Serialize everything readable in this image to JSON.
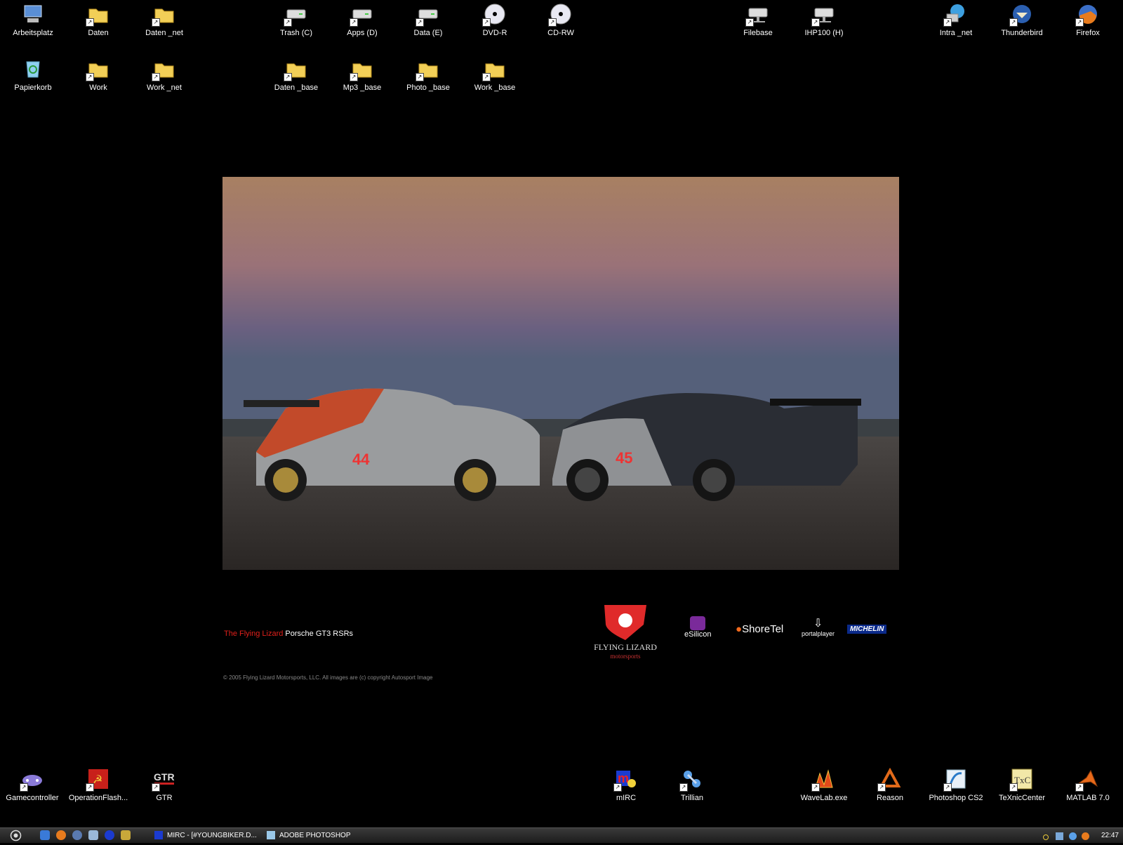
{
  "desktop": {
    "icons_top": [
      {
        "label": "Arbeitsplatz",
        "icon": "computer-icon"
      },
      {
        "label": "Daten",
        "icon": "folder-icon"
      },
      {
        "label": "Daten _net",
        "icon": "folder-icon"
      },
      {
        "label": "Trash (C)",
        "icon": "drive-icon"
      },
      {
        "label": "Apps (D)",
        "icon": "drive-icon"
      },
      {
        "label": "Data (E)",
        "icon": "drive-icon"
      },
      {
        "label": "DVD-R",
        "icon": "dvd-icon"
      },
      {
        "label": "CD-RW",
        "icon": "cd-icon"
      },
      {
        "label": "Filebase",
        "icon": "network-drive-icon"
      },
      {
        "label": "IHP100 (H)",
        "icon": "network-drive-icon"
      },
      {
        "label": "Intra _net",
        "icon": "network-icon"
      },
      {
        "label": "Thunderbird",
        "icon": "thunderbird-icon"
      },
      {
        "label": "Firefox",
        "icon": "firefox-icon"
      },
      {
        "label": "Papierkorb",
        "icon": "recycle-bin-icon"
      },
      {
        "label": "Work",
        "icon": "folder-icon"
      },
      {
        "label": "Work _net",
        "icon": "folder-icon"
      },
      {
        "label": "Daten _base",
        "icon": "folder-icon"
      },
      {
        "label": "Mp3 _base",
        "icon": "folder-icon"
      },
      {
        "label": "Photo _base",
        "icon": "folder-icon"
      },
      {
        "label": "Work _base",
        "icon": "folder-icon"
      }
    ],
    "icons_bottom": [
      {
        "label": "Gamecontroller",
        "icon": "gamepad-icon"
      },
      {
        "label": "OperationFlash...",
        "icon": "operation-flashpoint-icon"
      },
      {
        "label": "GTR",
        "icon": "gtr-icon"
      },
      {
        "label": "mIRC",
        "icon": "mirc-icon"
      },
      {
        "label": "Trillian",
        "icon": "trillian-icon"
      },
      {
        "label": "WaveLab.exe",
        "icon": "wavelab-icon"
      },
      {
        "label": "Reason",
        "icon": "reason-icon"
      },
      {
        "label": "Photoshop CS2",
        "icon": "photoshop-icon"
      },
      {
        "label": "TeXnicCenter",
        "icon": "texniccenter-icon"
      },
      {
        "label": "MATLAB 7.0",
        "icon": "matlab-icon"
      }
    ]
  },
  "wallpaper": {
    "caption_red": "The Flying Lizard",
    "caption_white": " Porsche GT3 RSRs",
    "copyright": "© 2005 Flying Lizard Motorsports, LLC. All images are (c) copyright Autosport Image",
    "car1_number": "44",
    "car2_number": "45",
    "sponsors": {
      "flying_lizard_1": "FLYING LIZARD",
      "flying_lizard_2": "motorsports",
      "esilicon": "eSilicon",
      "shoretel": "ShoreTel",
      "portalplayer": "portalplayer",
      "michelin": "MICHELIN"
    }
  },
  "taskbar": {
    "tasks": [
      {
        "label": "MIRC - [#YOUNGBIKER.D...",
        "icon": "mirc-icon"
      },
      {
        "label": "ADOBE PHOTOSHOP",
        "icon": "photoshop-icon"
      }
    ],
    "clock": "22:47"
  },
  "colors": {
    "accent_red": "#e0201b",
    "background": "#000000"
  }
}
